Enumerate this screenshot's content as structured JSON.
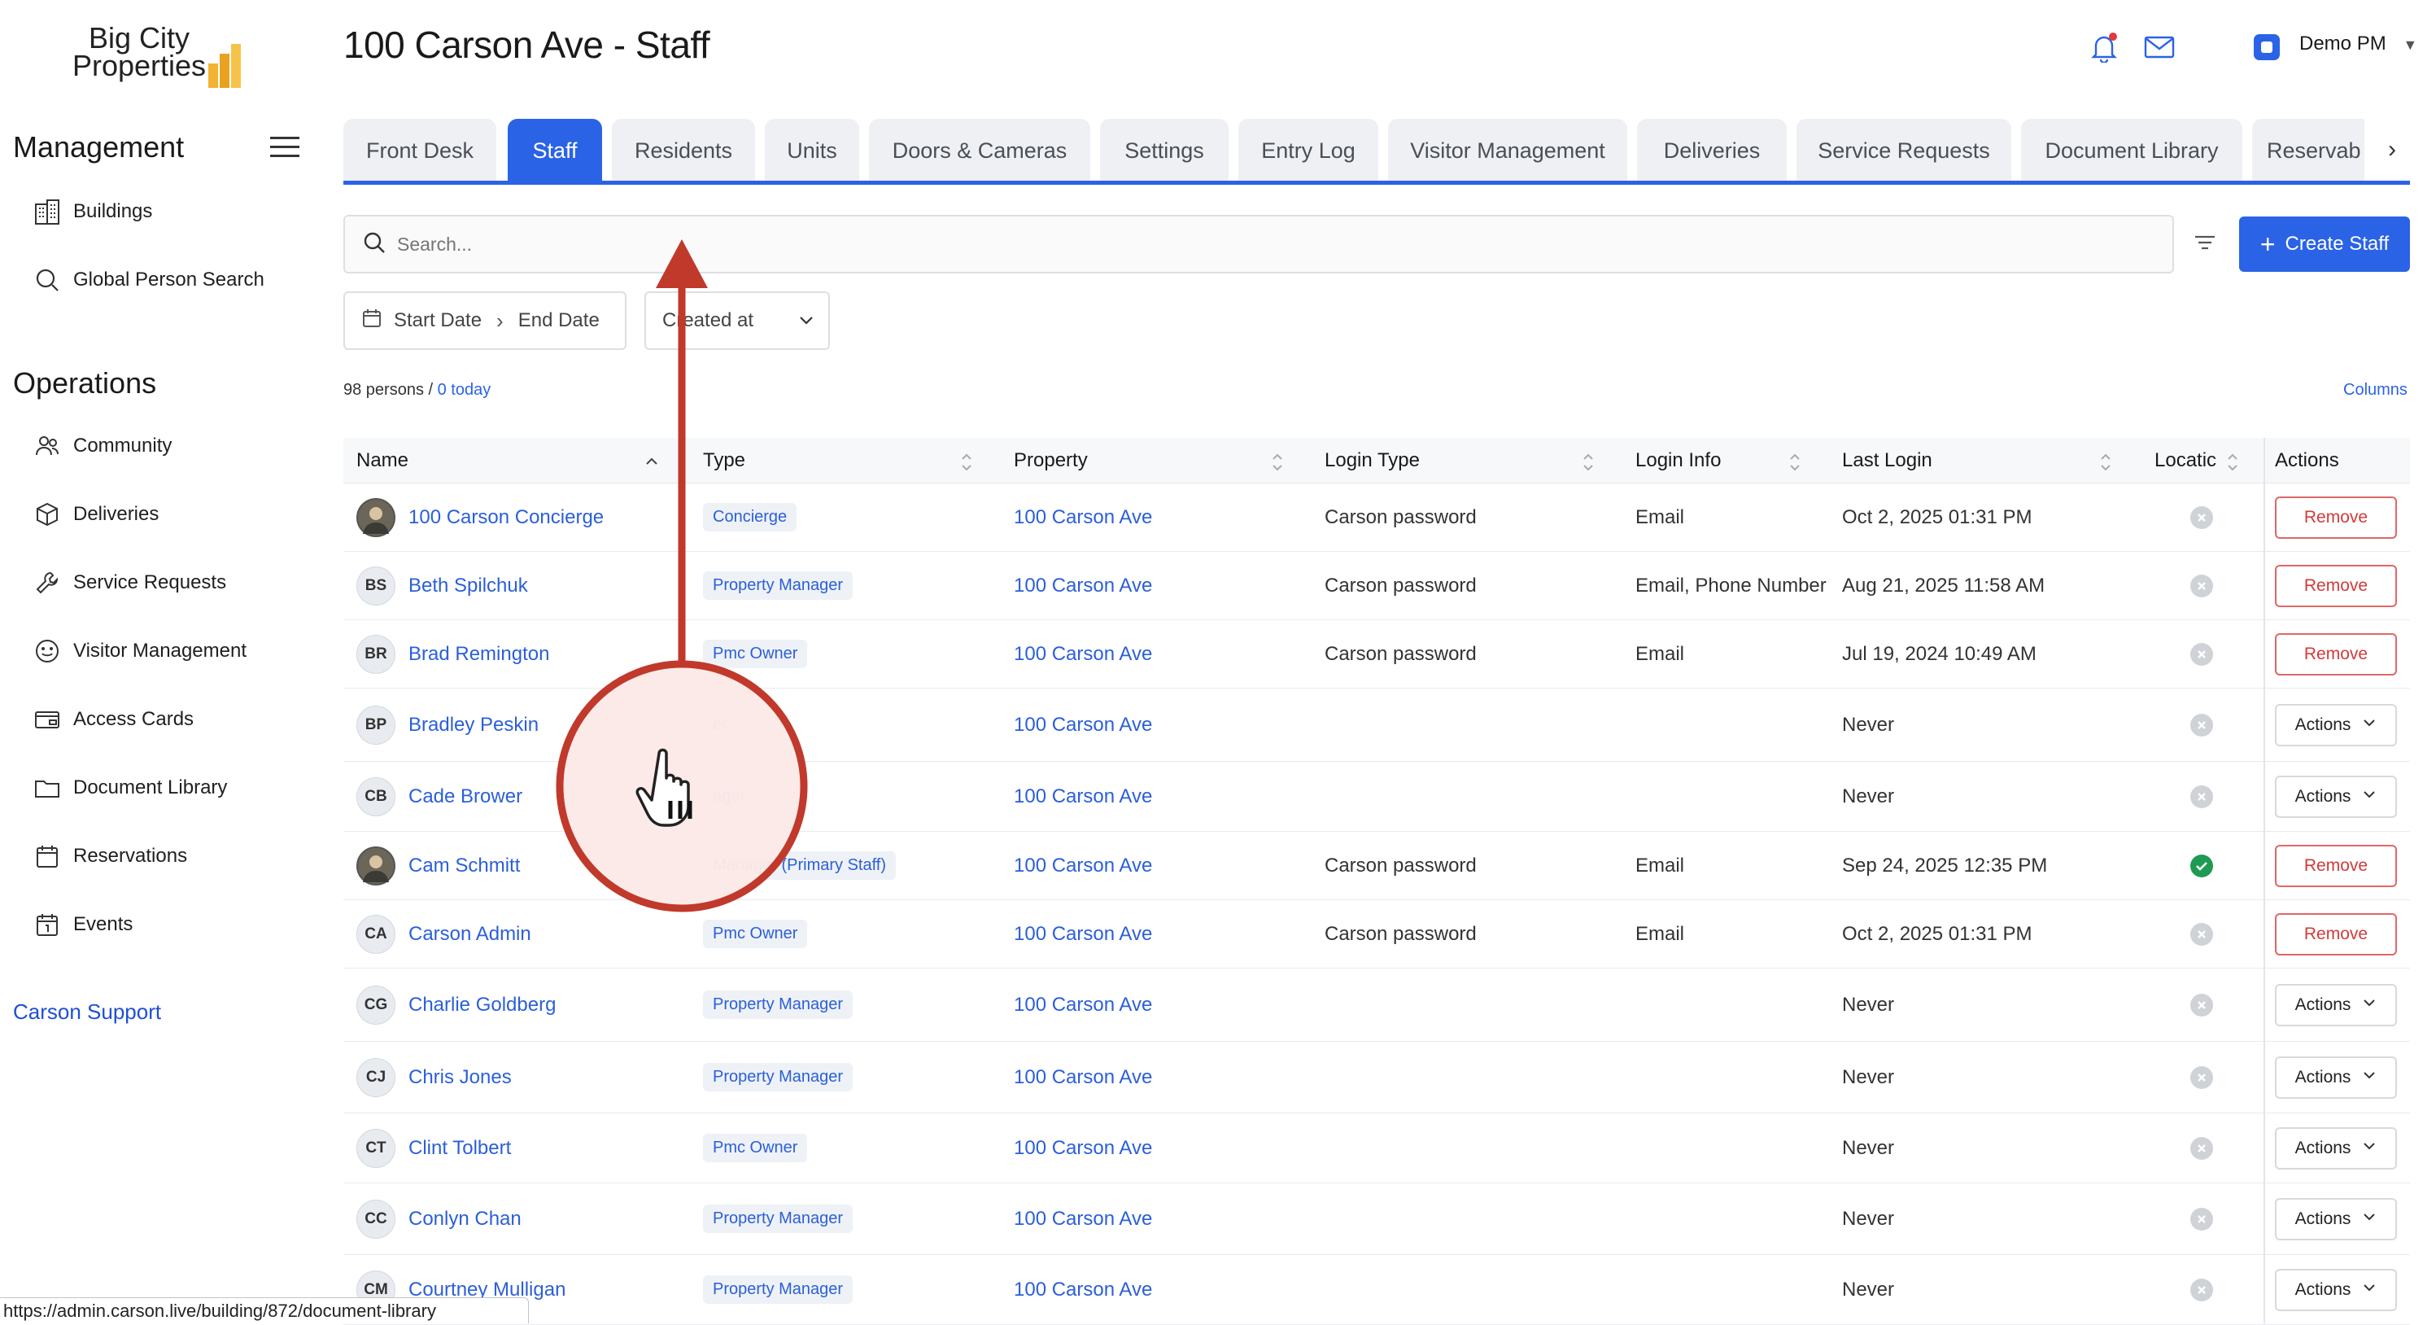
{
  "brand": {
    "line1": "Big City",
    "line2": "Properties"
  },
  "sidebar": {
    "management_title": "Management",
    "management_items": [
      {
        "label": "Buildings",
        "icon": "building-icon"
      },
      {
        "label": "Global Person Search",
        "icon": "search-icon"
      }
    ],
    "operations_title": "Operations",
    "operations_items": [
      {
        "label": "Community",
        "icon": "people-icon"
      },
      {
        "label": "Deliveries",
        "icon": "package-icon"
      },
      {
        "label": "Service Requests",
        "icon": "wrench-icon"
      },
      {
        "label": "Visitor Management",
        "icon": "smiley-icon"
      },
      {
        "label": "Access Cards",
        "icon": "card-icon"
      },
      {
        "label": "Document Library",
        "icon": "folder-icon"
      },
      {
        "label": "Reservations",
        "icon": "calendar-icon"
      },
      {
        "label": "Events",
        "icon": "calendar-events-icon"
      }
    ],
    "support_link": "Carson Support"
  },
  "header": {
    "title": "100 Carson Ave - Staff",
    "user": "Demo PM"
  },
  "tabs": [
    "Front Desk",
    "Staff",
    "Residents",
    "Units",
    "Doors & Cameras",
    "Settings",
    "Entry Log",
    "Visitor Management",
    "Deliveries",
    "Service Requests",
    "Document Library",
    "Reservab"
  ],
  "active_tab": "Staff",
  "search": {
    "placeholder": "Search..."
  },
  "create_button": "Create Staff",
  "date_filter": {
    "start": "Start Date",
    "end": "End Date"
  },
  "sort_select": "Created at",
  "summary": {
    "count": "98 persons / ",
    "today": "0 today"
  },
  "columns_link": "Columns",
  "table": {
    "headers": [
      "Name",
      "Type",
      "Property",
      "Login Type",
      "Login Info",
      "Last Login",
      "Locatic",
      "Actions"
    ],
    "rows": [
      {
        "initials": "",
        "photo": true,
        "name": "100 Carson Concierge",
        "type": "Concierge",
        "property": "100 Carson Ave",
        "login_type": "Carson password",
        "login_info": "Email",
        "last_login": "Oct 2, 2025 01:31 PM",
        "location": "x",
        "action": "Remove"
      },
      {
        "initials": "BS",
        "photo": false,
        "name": "Beth Spilchuk",
        "type": "Property Manager",
        "property": "100 Carson Ave",
        "login_type": "Carson password",
        "login_info": "Email, Phone Number",
        "last_login": "Aug 21, 2025 11:58 AM",
        "location": "x",
        "action": "Remove"
      },
      {
        "initials": "BR",
        "photo": false,
        "name": "Brad Remington",
        "type": "Pmc Owner",
        "property": "100 Carson Ave",
        "login_type": "Carson password",
        "login_info": "Email",
        "last_login": "Jul 19, 2024 10:49 AM",
        "location": "x",
        "action": "Remove"
      },
      {
        "initials": "BP",
        "photo": false,
        "name": "Bradley Peskin",
        "type": "er",
        "property": "100 Carson Ave",
        "login_type": "",
        "login_info": "",
        "last_login": "Never",
        "location": "x",
        "action": "Actions"
      },
      {
        "initials": "CB",
        "photo": false,
        "name": "Cade Brower",
        "type": "ager",
        "property": "100 Carson Ave",
        "login_type": "",
        "login_info": "",
        "last_login": "Never",
        "location": "x",
        "action": "Actions"
      },
      {
        "initials": "",
        "photo": true,
        "name": "Cam Schmitt",
        "type": "Manager (Primary Staff)",
        "property": "100 Carson Ave",
        "login_type": "Carson password",
        "login_info": "Email",
        "last_login": "Sep 24, 2025 12:35 PM",
        "location": "check",
        "action": "Remove"
      },
      {
        "initials": "CA",
        "photo": false,
        "name": "Carson Admin",
        "type": "Pmc Owner",
        "property": "100 Carson Ave",
        "login_type": "Carson password",
        "login_info": "Email",
        "last_login": "Oct 2, 2025 01:31 PM",
        "location": "x",
        "action": "Remove"
      },
      {
        "initials": "CG",
        "photo": false,
        "name": "Charlie Goldberg",
        "type": "Property Manager",
        "property": "100 Carson Ave",
        "login_type": "",
        "login_info": "",
        "last_login": "Never",
        "location": "x",
        "action": "Actions"
      },
      {
        "initials": "CJ",
        "photo": false,
        "name": "Chris Jones",
        "type": "Property Manager",
        "property": "100 Carson Ave",
        "login_type": "",
        "login_info": "",
        "last_login": "Never",
        "location": "x",
        "action": "Actions"
      },
      {
        "initials": "CT",
        "photo": false,
        "name": "Clint Tolbert",
        "type": "Pmc Owner",
        "property": "100 Carson Ave",
        "login_type": "",
        "login_info": "",
        "last_login": "Never",
        "location": "x",
        "action": "Actions"
      },
      {
        "initials": "CC",
        "photo": false,
        "name": "Conlyn Chan",
        "type": "Property Manager",
        "property": "100 Carson Ave",
        "login_type": "",
        "login_info": "",
        "last_login": "Never",
        "location": "x",
        "action": "Actions"
      },
      {
        "initials": "CM",
        "photo": false,
        "name": "Courtney Mulligan",
        "type": "Property Manager",
        "property": "100 Carson Ave",
        "login_type": "",
        "login_info": "",
        "last_login": "Never",
        "location": "x",
        "action": "Actions"
      }
    ]
  },
  "status_url": "https://admin.carson.live/building/872/document-library",
  "colors": {
    "accent": "#2b63e6",
    "danger": "#d33a3a",
    "annotation": "#c0392b"
  }
}
